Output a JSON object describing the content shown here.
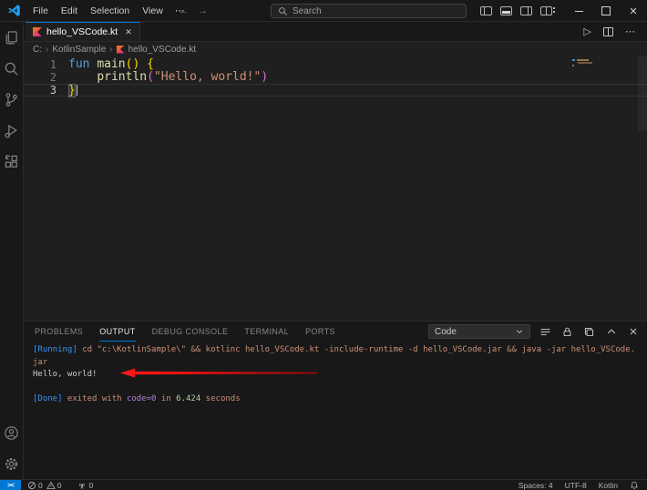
{
  "titlebar": {
    "menus": [
      "File",
      "Edit",
      "Selection",
      "View"
    ],
    "more_label": "⋯",
    "nav_back": "←",
    "nav_forward": "→",
    "search_placeholder": "Search"
  },
  "activity_bar": {
    "items": [
      "explorer",
      "search",
      "source-control",
      "run-and-debug",
      "extensions"
    ],
    "bottom_items": [
      "accounts",
      "settings"
    ]
  },
  "editor_tabs": {
    "active_tab": {
      "label": "hello_VSCode.kt",
      "close": "✕"
    },
    "run_action": "▷",
    "more_actions": "⋯"
  },
  "breadcrumb": {
    "crumbs": [
      "C:",
      "KotlinSample",
      "hello_VSCode.kt"
    ],
    "separator": "›"
  },
  "editor": {
    "lines": [
      {
        "num": "1",
        "tokens": [
          {
            "t": "fun",
            "c": "keyword"
          },
          {
            "t": " ",
            "c": "plain"
          },
          {
            "t": "main",
            "c": "function"
          },
          {
            "t": "()",
            "c": "bracket1"
          },
          {
            "t": " ",
            "c": "plain"
          },
          {
            "t": "{",
            "c": "bracket1"
          }
        ]
      },
      {
        "num": "2",
        "tokens": [
          {
            "t": "    ",
            "c": "plain"
          },
          {
            "t": "println",
            "c": "function"
          },
          {
            "t": "(",
            "c": "bracket2"
          },
          {
            "t": "\"Hello, world!\"",
            "c": "string"
          },
          {
            "t": ")",
            "c": "bracket2"
          }
        ]
      },
      {
        "num": "3",
        "current": true,
        "tokens": [
          {
            "t": "}",
            "c": "bracket1",
            "match": true,
            "cursor": true
          }
        ]
      }
    ]
  },
  "panel": {
    "tabs": [
      "PROBLEMS",
      "OUTPUT",
      "DEBUG CONSOLE",
      "TERMINAL",
      "PORTS"
    ],
    "active_tab": "OUTPUT",
    "channel_select": "Code",
    "output_lines": [
      {
        "tokens": [
          {
            "t": "[Running]",
            "c": "info"
          },
          {
            "t": " cd \"c:\\KotlinSample\\\" && kotlinc hello_VSCode.kt -include-runtime -d hello_VSCode.jar && java -jar hello_VSCode.",
            "c": "command"
          }
        ]
      },
      {
        "tokens": [
          {
            "t": "jar",
            "c": "command"
          }
        ]
      },
      {
        "tokens": [
          {
            "t": "Hello, world!",
            "c": "plain"
          }
        ]
      },
      {
        "tokens": []
      },
      {
        "tokens": [
          {
            "t": "[Done]",
            "c": "info"
          },
          {
            "t": " exited with ",
            "c": "command"
          },
          {
            "t": "code=0",
            "c": "code"
          },
          {
            "t": " in ",
            "c": "command"
          },
          {
            "t": "6.424",
            "c": "num"
          },
          {
            "t": " seconds",
            "c": "command"
          }
        ]
      }
    ]
  },
  "status_bar": {
    "remote": "><",
    "errors": "0",
    "warnings": "0",
    "ports": "0",
    "right_items": [
      "Spaces: 4",
      "UTF-8",
      "Kotlin"
    ]
  },
  "colors": {
    "accent": "#0078d4",
    "remote_bg": "#0078d4",
    "arrow": "#e01010",
    "tokens": {
      "keyword": "#569cd6",
      "function": "#dcdcaa",
      "bracket1": "#ffd700",
      "bracket2": "#da70d6",
      "string": "#ce9178",
      "plain": "#cccccc",
      "info": "#3794ff",
      "command": "#ce9178",
      "code": "#b180d7",
      "num": "#b5cea8"
    }
  }
}
